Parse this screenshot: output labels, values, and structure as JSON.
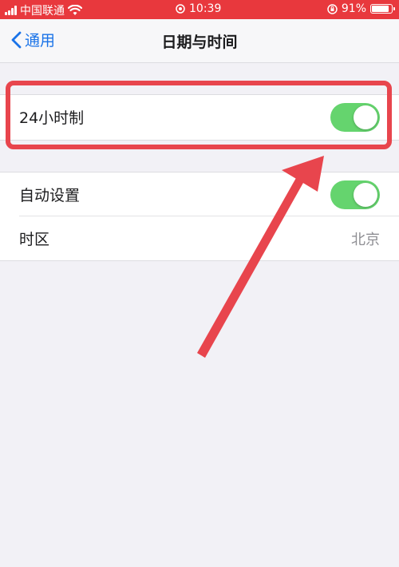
{
  "status_bar": {
    "carrier": "中国联通",
    "time": "10:39",
    "battery": "91%",
    "battery_level": 0.91
  },
  "nav": {
    "back_label": "通用",
    "title": "日期与时间"
  },
  "settings": {
    "hour24": {
      "label": "24小时制",
      "on": true
    },
    "auto_set": {
      "label": "自动设置",
      "on": true
    },
    "timezone": {
      "label": "时区",
      "value": "北京"
    }
  },
  "colors": {
    "status_bar_bg": "#e8383d",
    "toggle_on": "#65d46e",
    "annotation": "#e8454d",
    "link": "#1a73e8"
  },
  "icons": {
    "back": "chevron-left-icon",
    "wifi": "wifi-icon",
    "signal": "signal-icon",
    "lock": "orientation-lock-icon",
    "battery": "battery-icon"
  }
}
